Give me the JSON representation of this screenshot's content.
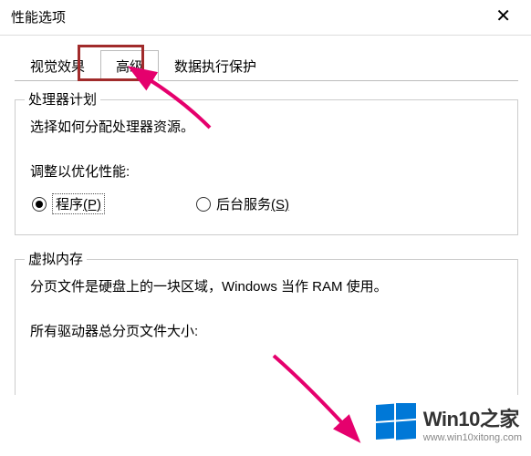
{
  "window": {
    "title": "性能选项"
  },
  "tabs": {
    "visual": "视觉效果",
    "advanced": "高级",
    "dep": "数据执行保护"
  },
  "processor": {
    "title": "处理器计划",
    "desc": "选择如何分配处理器资源。",
    "adjust_label": "调整以优化性能:",
    "programs_label": "程序",
    "programs_hotkey": "(P)",
    "services_label": "后台服务",
    "services_hotkey": "(S)"
  },
  "vm": {
    "title": "虚拟内存",
    "desc": "分页文件是硬盘上的一块区域，Windows 当作 RAM 使用。",
    "total_label": "所有驱动器总分页文件大小:"
  },
  "watermark": {
    "brand": "Win10之家",
    "url": "www.win10xitong.com"
  },
  "accent_color": "#e5006d"
}
